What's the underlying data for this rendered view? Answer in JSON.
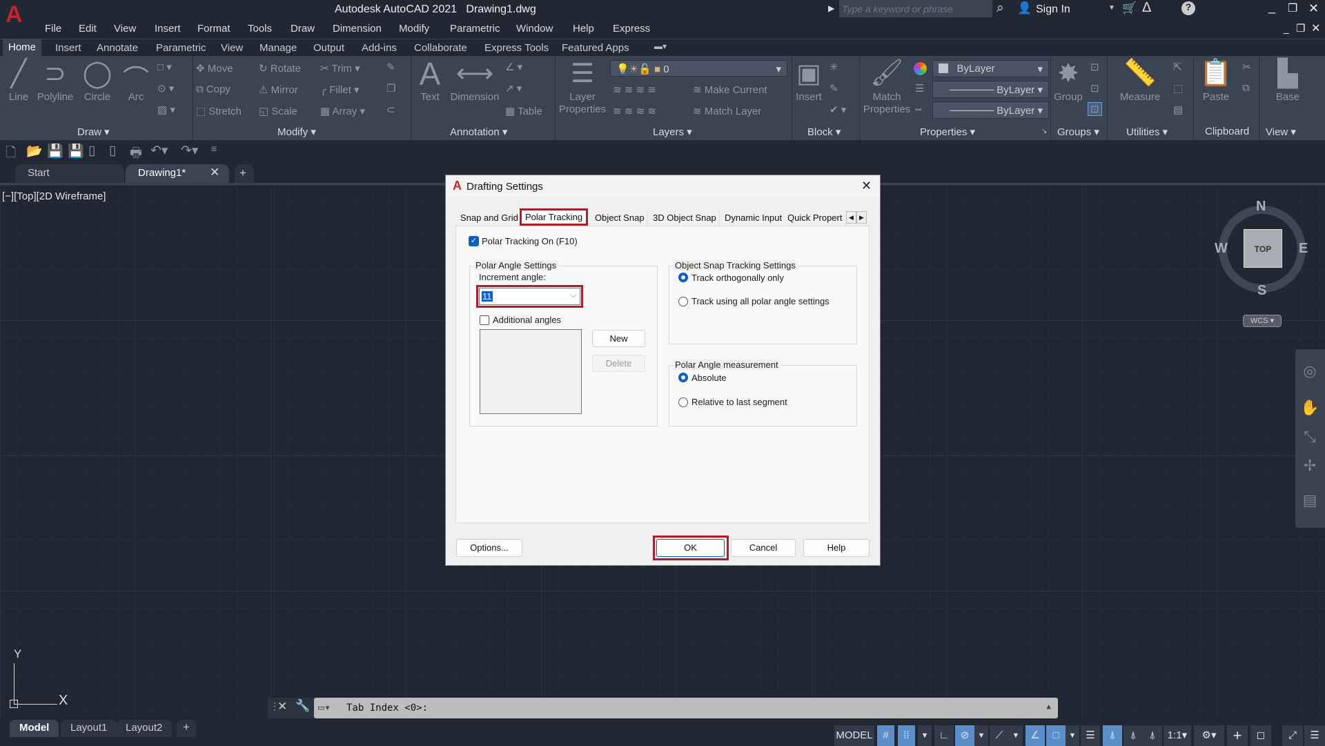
{
  "title": {
    "app": "Autodesk AutoCAD 2021",
    "file": "Drawing1.dwg",
    "search_placeholder": "Type a keyword or phrase",
    "sign_in": "Sign In"
  },
  "menu": [
    "File",
    "Edit",
    "View",
    "Insert",
    "Format",
    "Tools",
    "Draw",
    "Dimension",
    "Modify",
    "Parametric",
    "Window",
    "Help",
    "Express"
  ],
  "ribbon_tabs": [
    "Home",
    "Insert",
    "Annotate",
    "Parametric",
    "View",
    "Manage",
    "Output",
    "Add-ins",
    "Collaborate",
    "Express Tools",
    "Featured Apps"
  ],
  "panels": [
    "Draw",
    "Modify",
    "Annotation",
    "Layers",
    "Block",
    "Properties",
    "Groups",
    "Utilities",
    "Clipboard",
    "View"
  ],
  "draw": {
    "line": "Line",
    "polyline": "Polyline",
    "circle": "Circle",
    "arc": "Arc"
  },
  "modify": {
    "move": "Move",
    "copy": "Copy",
    "stretch": "Stretch",
    "rotate": "Rotate",
    "mirror": "Mirror",
    "scale": "Scale",
    "trim": "Trim",
    "fillet": "Fillet",
    "array": "Array"
  },
  "annotation": {
    "text": "Text",
    "dimension": "Dimension",
    "table": "Table"
  },
  "layers": {
    "layer_properties": "Layer Properties",
    "current_layer": "0",
    "make_current": "Make Current",
    "match_layer": "Match Layer"
  },
  "block": {
    "insert": "Insert"
  },
  "properties": {
    "match_properties": "Match Properties",
    "color": "ByLayer",
    "linetype": "ByLayer",
    "lineweight": "ByLayer"
  },
  "groups": {
    "group": "Group"
  },
  "utilities": {
    "measure": "Measure"
  },
  "clipboard": {
    "paste": "Paste"
  },
  "view": {
    "base": "Base"
  },
  "file_tabs": [
    "Start",
    "Drawing1*"
  ],
  "viewport_label": "[−][Top][2D Wireframe]",
  "viewcube": {
    "n": "N",
    "s": "S",
    "e": "E",
    "w": "W",
    "face": "TOP",
    "ucs": "WCS"
  },
  "ucs_icon": {
    "x": "X",
    "y": "Y"
  },
  "dialog": {
    "title": "Drafting Settings",
    "tabs": [
      "Snap and Grid",
      "Polar Tracking",
      "Object Snap",
      "3D Object Snap",
      "Dynamic Input",
      "Quick Propert"
    ],
    "active_tab": "Polar Tracking",
    "polar_on": {
      "label": "Polar Tracking On (F10)",
      "checked": true
    },
    "polar_angle_settings": {
      "title": "Polar Angle Settings",
      "increment_label": "Increment angle:",
      "increment_value": "11",
      "additional_label": "Additional angles",
      "additional_checked": false,
      "new": "New",
      "delete": "Delete"
    },
    "osnap_tracking": {
      "title": "Object Snap Tracking Settings",
      "options": [
        "Track orthogonally only",
        "Track using all polar angle settings"
      ],
      "selected": 0
    },
    "measurement": {
      "title": "Polar Angle measurement",
      "options": [
        "Absolute",
        "Relative to last segment"
      ],
      "selected": 0
    },
    "buttons": {
      "options": "Options...",
      "ok": "OK",
      "cancel": "Cancel",
      "help": "Help"
    }
  },
  "command_line": {
    "text": "Tab Index <0>:"
  },
  "layout_tabs": [
    "Model",
    "Layout1",
    "Layout2"
  ],
  "status": {
    "model": "MODEL",
    "scale": "1:1"
  },
  "colors": {
    "accent_red": "#b01e2e",
    "active_blue": "#5b8fc9",
    "ribbon": "#3b4453",
    "background": "#222833"
  }
}
